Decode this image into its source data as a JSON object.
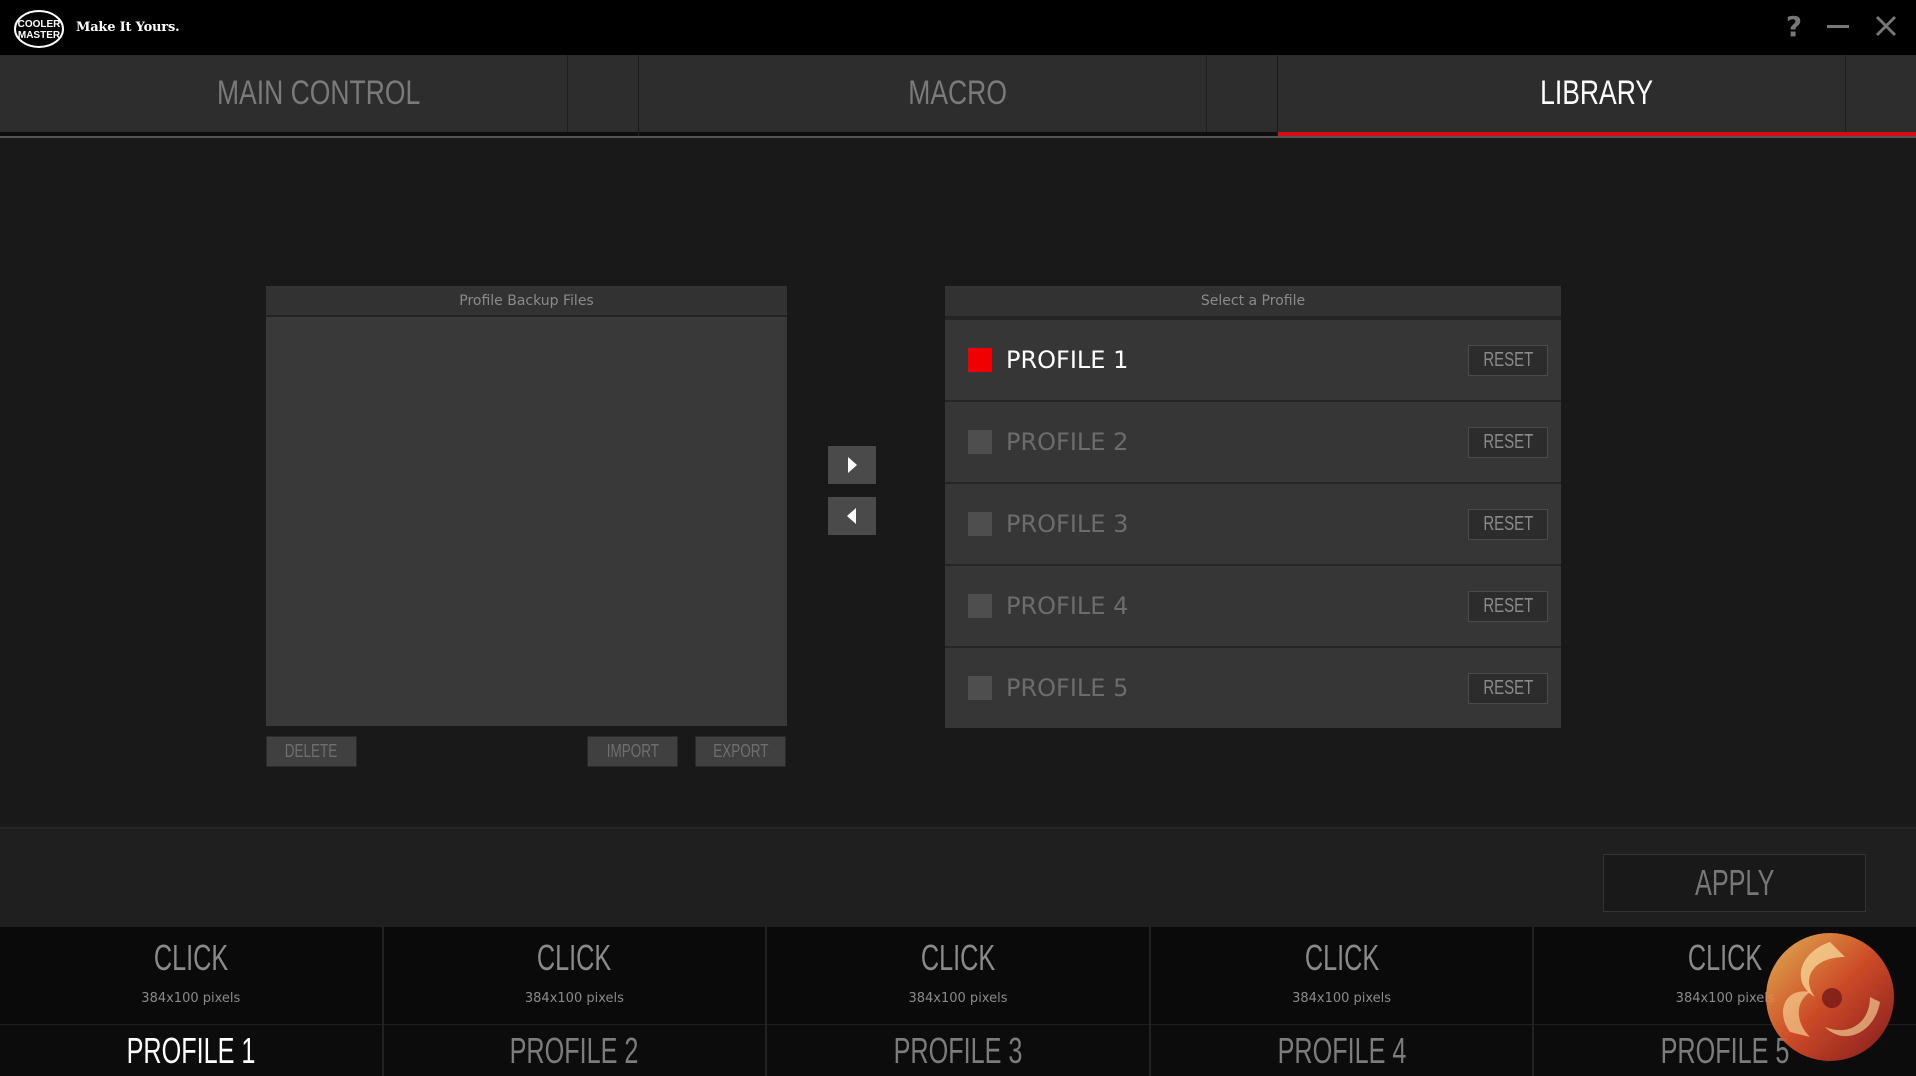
{
  "app": {
    "logo_text_line1": "COOLER",
    "logo_text_line2": "MASTER",
    "tagline": "Make It Yours."
  },
  "window_controls": {
    "help": "?",
    "minimize": "minimize-icon",
    "close": "close-icon"
  },
  "tabs": [
    {
      "label": "MAIN CONTROL",
      "active": false
    },
    {
      "label": "MACRO",
      "active": false
    },
    {
      "label": "LIBRARY",
      "active": true
    }
  ],
  "backup_panel": {
    "title": "Profile Backup Files",
    "files": [],
    "buttons": {
      "delete": "DELETE",
      "import": "IMPORT",
      "export": "EXPORT"
    }
  },
  "transfer": {
    "right_icon": "play-right-icon",
    "left_icon": "play-left-icon"
  },
  "profile_panel": {
    "title": "Select a Profile",
    "profiles": [
      {
        "name": "PROFILE 1",
        "selected": true,
        "reset": "RESET"
      },
      {
        "name": "PROFILE 2",
        "selected": false,
        "reset": "RESET"
      },
      {
        "name": "PROFILE 3",
        "selected": false,
        "reset": "RESET"
      },
      {
        "name": "PROFILE 4",
        "selected": false,
        "reset": "RESET"
      },
      {
        "name": "PROFILE 5",
        "selected": false,
        "reset": "RESET"
      }
    ]
  },
  "apply": {
    "label": "APPLY"
  },
  "bottom_profiles": [
    {
      "click": "CLICK",
      "pixels": "384x100 pixels",
      "label": "PROFILE 1",
      "active": true
    },
    {
      "click": "CLICK",
      "pixels": "384x100 pixels",
      "label": "PROFILE 2",
      "active": false
    },
    {
      "click": "CLICK",
      "pixels": "384x100 pixels",
      "label": "PROFILE 3",
      "active": false
    },
    {
      "click": "CLICK",
      "pixels": "384x100 pixels",
      "label": "PROFILE 4",
      "active": false
    },
    {
      "click": "CLICK",
      "pixels": "384x100 pixels",
      "label": "PROFILE 5",
      "active": false
    }
  ],
  "colors": {
    "accent": "#d40d12",
    "selected_check": "#f10000",
    "background": "#191919"
  }
}
